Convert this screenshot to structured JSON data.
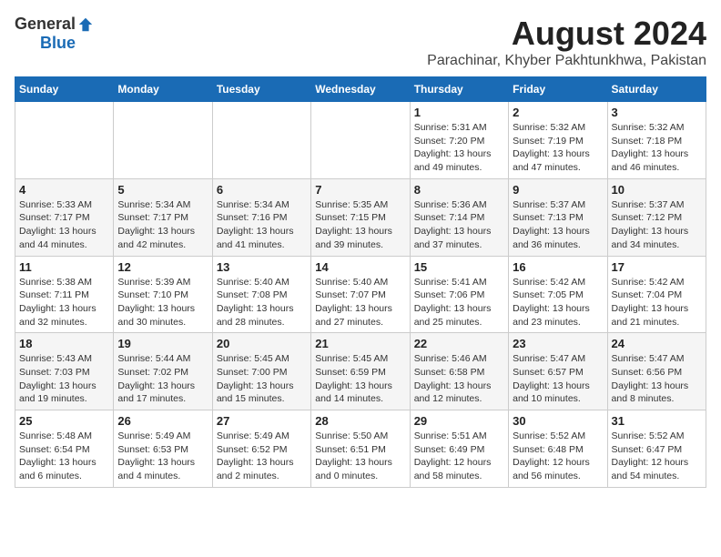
{
  "header": {
    "logo_general": "General",
    "logo_blue": "Blue",
    "main_title": "August 2024",
    "subtitle": "Parachinar, Khyber Pakhtunkhwa, Pakistan"
  },
  "calendar": {
    "days_of_week": [
      "Sunday",
      "Monday",
      "Tuesday",
      "Wednesday",
      "Thursday",
      "Friday",
      "Saturday"
    ],
    "weeks": [
      [
        {
          "day": "",
          "info": ""
        },
        {
          "day": "",
          "info": ""
        },
        {
          "day": "",
          "info": ""
        },
        {
          "day": "",
          "info": ""
        },
        {
          "day": "1",
          "info": "Sunrise: 5:31 AM\nSunset: 7:20 PM\nDaylight: 13 hours\nand 49 minutes."
        },
        {
          "day": "2",
          "info": "Sunrise: 5:32 AM\nSunset: 7:19 PM\nDaylight: 13 hours\nand 47 minutes."
        },
        {
          "day": "3",
          "info": "Sunrise: 5:32 AM\nSunset: 7:18 PM\nDaylight: 13 hours\nand 46 minutes."
        }
      ],
      [
        {
          "day": "4",
          "info": "Sunrise: 5:33 AM\nSunset: 7:17 PM\nDaylight: 13 hours\nand 44 minutes."
        },
        {
          "day": "5",
          "info": "Sunrise: 5:34 AM\nSunset: 7:17 PM\nDaylight: 13 hours\nand 42 minutes."
        },
        {
          "day": "6",
          "info": "Sunrise: 5:34 AM\nSunset: 7:16 PM\nDaylight: 13 hours\nand 41 minutes."
        },
        {
          "day": "7",
          "info": "Sunrise: 5:35 AM\nSunset: 7:15 PM\nDaylight: 13 hours\nand 39 minutes."
        },
        {
          "day": "8",
          "info": "Sunrise: 5:36 AM\nSunset: 7:14 PM\nDaylight: 13 hours\nand 37 minutes."
        },
        {
          "day": "9",
          "info": "Sunrise: 5:37 AM\nSunset: 7:13 PM\nDaylight: 13 hours\nand 36 minutes."
        },
        {
          "day": "10",
          "info": "Sunrise: 5:37 AM\nSunset: 7:12 PM\nDaylight: 13 hours\nand 34 minutes."
        }
      ],
      [
        {
          "day": "11",
          "info": "Sunrise: 5:38 AM\nSunset: 7:11 PM\nDaylight: 13 hours\nand 32 minutes."
        },
        {
          "day": "12",
          "info": "Sunrise: 5:39 AM\nSunset: 7:10 PM\nDaylight: 13 hours\nand 30 minutes."
        },
        {
          "day": "13",
          "info": "Sunrise: 5:40 AM\nSunset: 7:08 PM\nDaylight: 13 hours\nand 28 minutes."
        },
        {
          "day": "14",
          "info": "Sunrise: 5:40 AM\nSunset: 7:07 PM\nDaylight: 13 hours\nand 27 minutes."
        },
        {
          "day": "15",
          "info": "Sunrise: 5:41 AM\nSunset: 7:06 PM\nDaylight: 13 hours\nand 25 minutes."
        },
        {
          "day": "16",
          "info": "Sunrise: 5:42 AM\nSunset: 7:05 PM\nDaylight: 13 hours\nand 23 minutes."
        },
        {
          "day": "17",
          "info": "Sunrise: 5:42 AM\nSunset: 7:04 PM\nDaylight: 13 hours\nand 21 minutes."
        }
      ],
      [
        {
          "day": "18",
          "info": "Sunrise: 5:43 AM\nSunset: 7:03 PM\nDaylight: 13 hours\nand 19 minutes."
        },
        {
          "day": "19",
          "info": "Sunrise: 5:44 AM\nSunset: 7:02 PM\nDaylight: 13 hours\nand 17 minutes."
        },
        {
          "day": "20",
          "info": "Sunrise: 5:45 AM\nSunset: 7:00 PM\nDaylight: 13 hours\nand 15 minutes."
        },
        {
          "day": "21",
          "info": "Sunrise: 5:45 AM\nSunset: 6:59 PM\nDaylight: 13 hours\nand 14 minutes."
        },
        {
          "day": "22",
          "info": "Sunrise: 5:46 AM\nSunset: 6:58 PM\nDaylight: 13 hours\nand 12 minutes."
        },
        {
          "day": "23",
          "info": "Sunrise: 5:47 AM\nSunset: 6:57 PM\nDaylight: 13 hours\nand 10 minutes."
        },
        {
          "day": "24",
          "info": "Sunrise: 5:47 AM\nSunset: 6:56 PM\nDaylight: 13 hours\nand 8 minutes."
        }
      ],
      [
        {
          "day": "25",
          "info": "Sunrise: 5:48 AM\nSunset: 6:54 PM\nDaylight: 13 hours\nand 6 minutes."
        },
        {
          "day": "26",
          "info": "Sunrise: 5:49 AM\nSunset: 6:53 PM\nDaylight: 13 hours\nand 4 minutes."
        },
        {
          "day": "27",
          "info": "Sunrise: 5:49 AM\nSunset: 6:52 PM\nDaylight: 13 hours\nand 2 minutes."
        },
        {
          "day": "28",
          "info": "Sunrise: 5:50 AM\nSunset: 6:51 PM\nDaylight: 13 hours\nand 0 minutes."
        },
        {
          "day": "29",
          "info": "Sunrise: 5:51 AM\nSunset: 6:49 PM\nDaylight: 12 hours\nand 58 minutes."
        },
        {
          "day": "30",
          "info": "Sunrise: 5:52 AM\nSunset: 6:48 PM\nDaylight: 12 hours\nand 56 minutes."
        },
        {
          "day": "31",
          "info": "Sunrise: 5:52 AM\nSunset: 6:47 PM\nDaylight: 12 hours\nand 54 minutes."
        }
      ]
    ]
  }
}
